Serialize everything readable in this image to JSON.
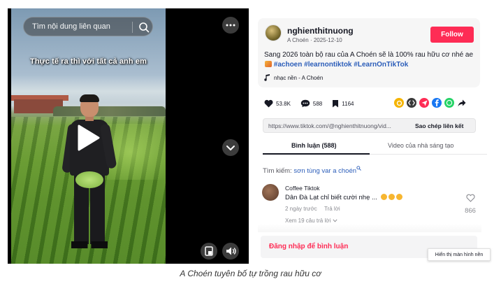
{
  "video": {
    "search_placeholder": "Tìm nội dung liên quan",
    "overlay_caption": "Thực tế ra thì với tất cả anh em"
  },
  "author": {
    "username": "nghienthitnuong",
    "display_name": "A Choén",
    "date": "2025-12-10",
    "follow_label": "Follow",
    "description": "Sang 2026 toàn bộ rau của A Choén sẽ là 100% rau hữu cơ nhé ae",
    "hashtags": [
      "#achoen",
      "#learnontiktok",
      "#LearnOnTikTok"
    ],
    "music": "nhạc nền - A Choén"
  },
  "actions": {
    "likes": "53.8K",
    "comments": "588",
    "saves": "1164"
  },
  "share": {
    "icons": [
      "wand-icon",
      "embed-icon",
      "send-icon",
      "facebook-icon",
      "whatsapp-icon",
      "share-arrow-icon"
    ],
    "colors": [
      "#f5b400",
      "#3a3a3a",
      "#fe2c55",
      "#1877f2",
      "#25d366",
      "#161823"
    ]
  },
  "link": {
    "url": "https://www.tiktok.com/@nghienthitnuong/vid...",
    "copy_label": "Sao chép liên kết"
  },
  "tabs": {
    "comments": "Bình luận (588)",
    "creator_videos": "Video của nhà sáng tạo"
  },
  "search_suggestion": {
    "prefix": "Tìm kiếm:",
    "keyword": "sơn tùng var a choén"
  },
  "comment": {
    "author": "Coffee Tiktok",
    "text": "Dân Đà Lạt chỉ biết cười nhẹ ...",
    "time": "2 ngày trước",
    "reply": "Trả lời",
    "likes": "866",
    "view_replies": "Xem 19 câu trả lời"
  },
  "login_prompt": "Đăng nhập để bình luận",
  "tooltip": "Hiển thị màn hình nền",
  "figure_caption": "A Choén tuyên bố tự trồng rau hữu cơ",
  "colors": {
    "accent": "#fe2c55",
    "hashtag": "#2b5db9"
  }
}
